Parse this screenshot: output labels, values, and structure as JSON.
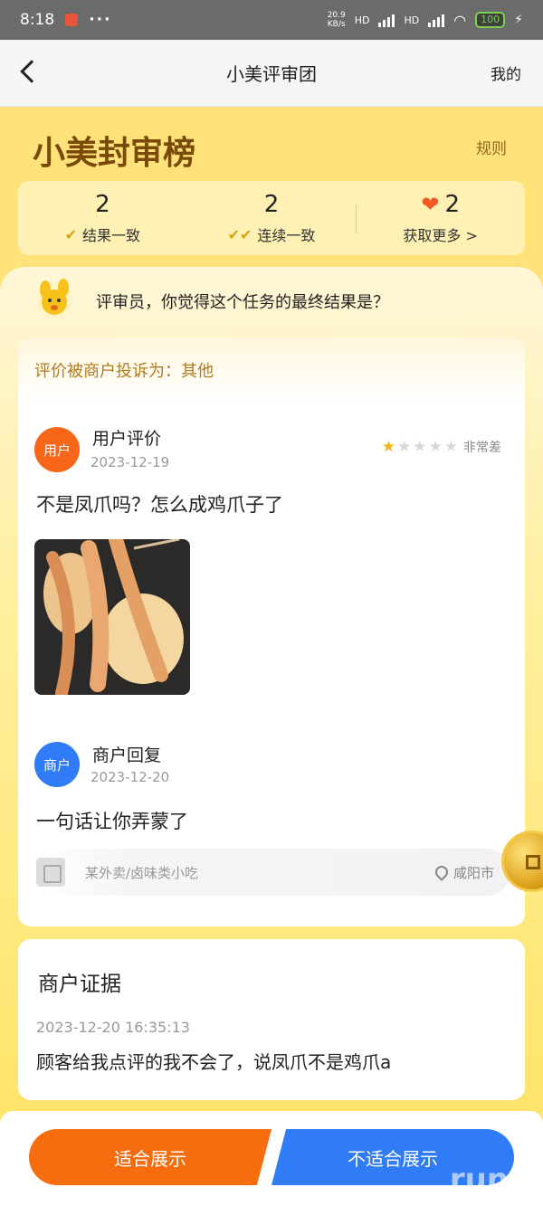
{
  "status_bar": {
    "time": "8:18",
    "speed_value": "20.9",
    "speed_unit": "KB/s",
    "network_1": "HD",
    "network_2": "HD",
    "battery": "100"
  },
  "header": {
    "title": "小美评审团",
    "mine_label": "我的"
  },
  "banner": {
    "title": "小美封审榜",
    "rules_label": "规则"
  },
  "stats": [
    {
      "value": "2",
      "label": "结果一致"
    },
    {
      "value": "2",
      "label": "连续一致"
    },
    {
      "value": "2",
      "label": "获取更多 >"
    }
  ],
  "question": "评审员，你觉得这个任务的最终结果是？",
  "review": {
    "complaint": "评价被商户投诉为：其他",
    "user": {
      "badge": "用户",
      "name": "用户评价",
      "date": "2023-12-19",
      "rating": 1,
      "rating_max": 5,
      "rating_text": "非常差",
      "text": "不是凤爪吗？怎么成鸡爪子了"
    },
    "merchant": {
      "badge": "商户",
      "name": "商户回复",
      "date": "2023-12-20",
      "text": "一句话让你弄蒙了"
    },
    "shop": {
      "category": "某外卖/卤味类小吃",
      "location": "咸阳市"
    }
  },
  "evidence": {
    "title": "商户证据",
    "time": "2023-12-20 16:35:13",
    "text": "顾客给我点评的我不会了，说凤爪不是鸡爪a"
  },
  "actions": {
    "suitable": "适合展示",
    "unsuitable": "不适合展示"
  },
  "colors": {
    "accent_orange": "#f86c10",
    "accent_blue": "#2f7cf6",
    "background_yellow": "#ffe37a",
    "brown_title": "#7a4a0a"
  },
  "watermark": "run"
}
